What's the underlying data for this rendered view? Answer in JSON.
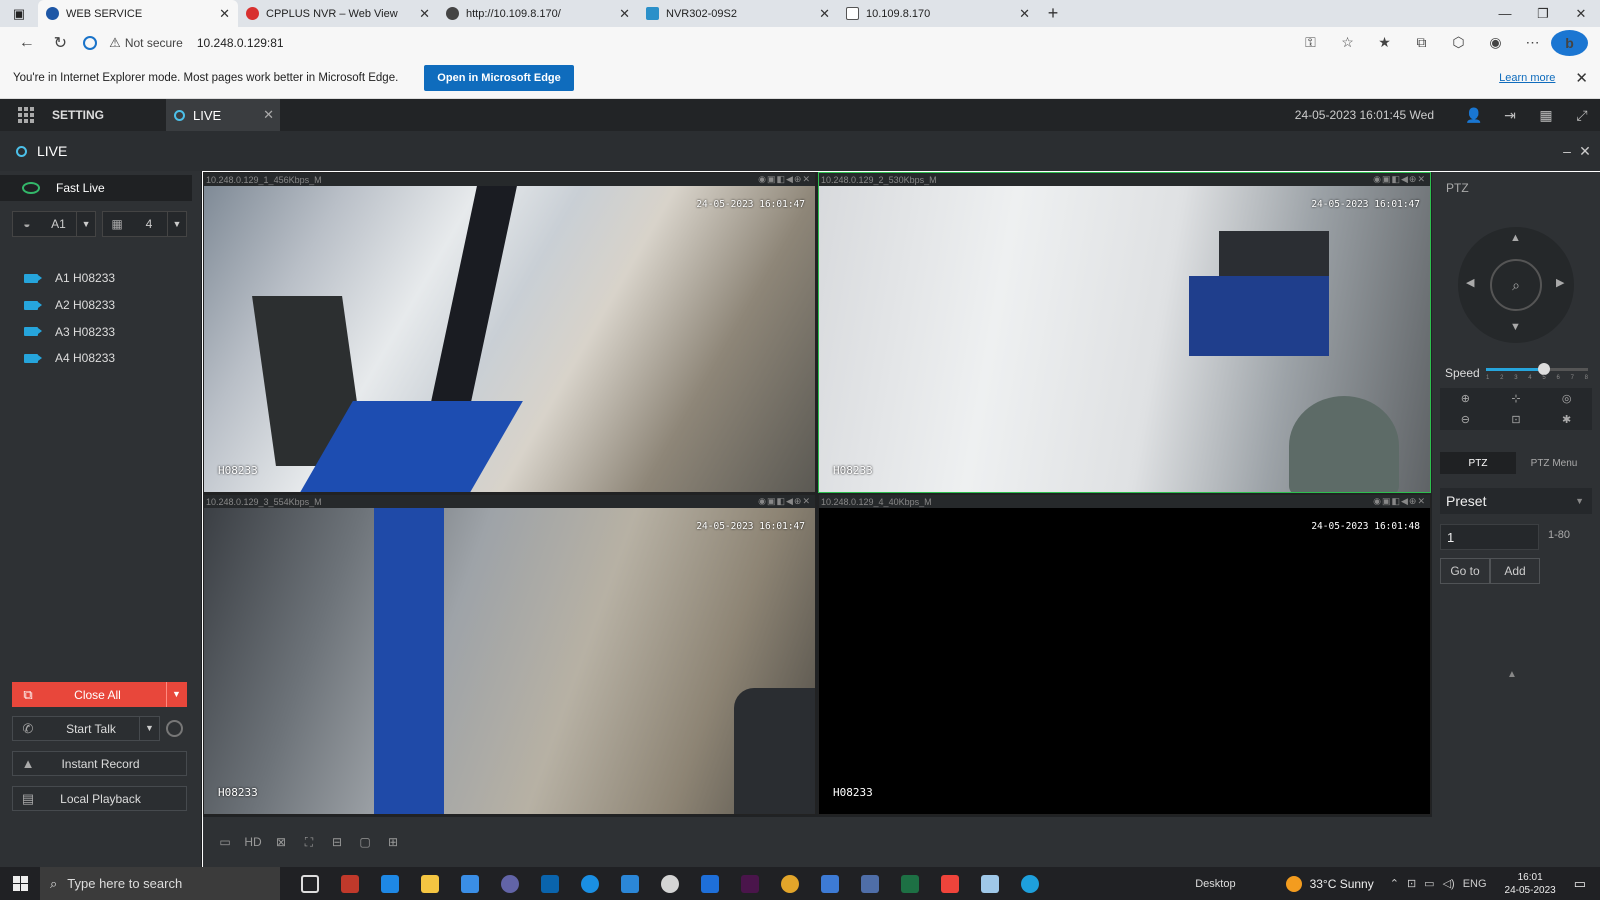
{
  "browser": {
    "tabs": [
      {
        "title": "WEB SERVICE",
        "active": true,
        "icon": "ie-page-icon"
      },
      {
        "title": "CPPLUS NVR – Web View",
        "active": false,
        "icon": "cpplus-icon"
      },
      {
        "title": "http://10.109.8.170/",
        "active": false,
        "icon": "ie-page-icon"
      },
      {
        "title": "NVR302-09S2",
        "active": false,
        "icon": "nvr-icon"
      },
      {
        "title": "10.109.8.170",
        "active": false,
        "icon": "page-icon"
      }
    ],
    "security_label": "Not secure",
    "url": "10.248.0.129:81"
  },
  "ie_bar": {
    "message": "You're in Internet Explorer mode. Most pages work better in Microsoft Edge.",
    "button": "Open in Microsoft Edge",
    "learn_more": "Learn more"
  },
  "app_header": {
    "setting": "SETTING",
    "live_tab": "LIVE",
    "datetime": "24-05-2023 16:01:45 Wed"
  },
  "live_bar": {
    "title": "LIVE"
  },
  "left_panel": {
    "fast_live": "Fast Live",
    "stream_select": "A1",
    "layout_select": "4",
    "channels": [
      {
        "label": "A1 H08233"
      },
      {
        "label": "A2 H08233"
      },
      {
        "label": "A3 H08233"
      },
      {
        "label": "A4 H08233"
      }
    ],
    "buttons": {
      "close_all": "Close All",
      "start_talk": "Start Talk",
      "instant_record": "Instant Record",
      "local_playback": "Local Playback"
    }
  },
  "panes": [
    {
      "header": "10.248.0.129_1_456Kbps_M",
      "timestamp": "24-05-2023 16:01:47",
      "camera_name": "H08233",
      "selected": false
    },
    {
      "header": "10.248.0.129_2_530Kbps_M",
      "timestamp": "24-05-2023 16:01:47",
      "camera_name": "H08233",
      "selected": true
    },
    {
      "header": "10.248.0.129_3_554Kbps_M",
      "timestamp": "24-05-2023 16:01:47",
      "camera_name": "H08233",
      "selected": false
    },
    {
      "header": "10.248.0.129_4_40Kbps_M",
      "timestamp": "24-05-2023 16:01:48",
      "camera_name": "H08233",
      "selected": false
    }
  ],
  "video_toolbar": {
    "hd_label": "HD"
  },
  "ptz": {
    "title": "PTZ",
    "speed_label": "Speed",
    "speed_ticks": [
      "1",
      "2",
      "3",
      "4",
      "5",
      "6",
      "7",
      "8"
    ],
    "speed_value": 5,
    "tabs": {
      "ptz": "PTZ",
      "ptz_menu": "PTZ Menu"
    },
    "preset_label": "Preset",
    "preset_value": "1",
    "preset_range": "1-80",
    "goto": "Go to",
    "add": "Add"
  },
  "taskbar": {
    "search_placeholder": "Type here to search",
    "desktop": "Desktop",
    "weather": "33°C  Sunny",
    "lang": "ENG",
    "time": "16:01",
    "date": "24-05-2023"
  },
  "colors": {
    "accent_blue": "#26a5dc",
    "close_all_red": "#e8473b",
    "selected_green": "#2dbf4e",
    "edge_blue": "#0f6cbd"
  }
}
